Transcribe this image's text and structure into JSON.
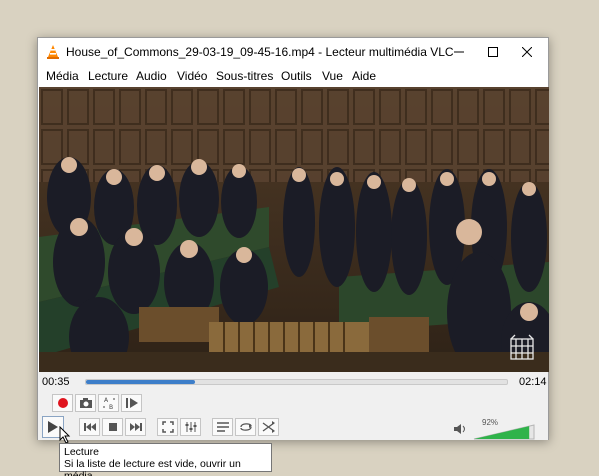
{
  "window": {
    "title": "House_of_Commons_29-03-19_09-45-16.mp4 - Lecteur multimédia VLC"
  },
  "menu": [
    "Média",
    "Lecture",
    "Audio",
    "Vidéo",
    "Sous-titres",
    "Outils",
    "Vue",
    "Aide"
  ],
  "playback": {
    "elapsed": "00:35",
    "total": "02:14",
    "progress": 0.26
  },
  "volume": {
    "percent_label": "92%",
    "level": 0.92
  },
  "tooltip": {
    "title": "Lecture",
    "text": "Si la liste de lecture est vide, ouvrir un média"
  },
  "colors": {
    "accent": "#3d7ec9",
    "volume": "#2fb34a",
    "record": "#e0141e"
  },
  "icons": [
    "vlc-cone-icon",
    "minimize-icon",
    "maximize-icon",
    "close-icon",
    "record-icon",
    "snapshot-icon",
    "loop-ab-icon",
    "frame-step-icon",
    "play-icon",
    "previous-icon",
    "stop-icon",
    "next-icon",
    "fullscreen-icon",
    "extended-settings-icon",
    "playlist-icon",
    "loop-icon",
    "shuffle-icon",
    "speaker-icon",
    "mouse-cursor-icon"
  ]
}
